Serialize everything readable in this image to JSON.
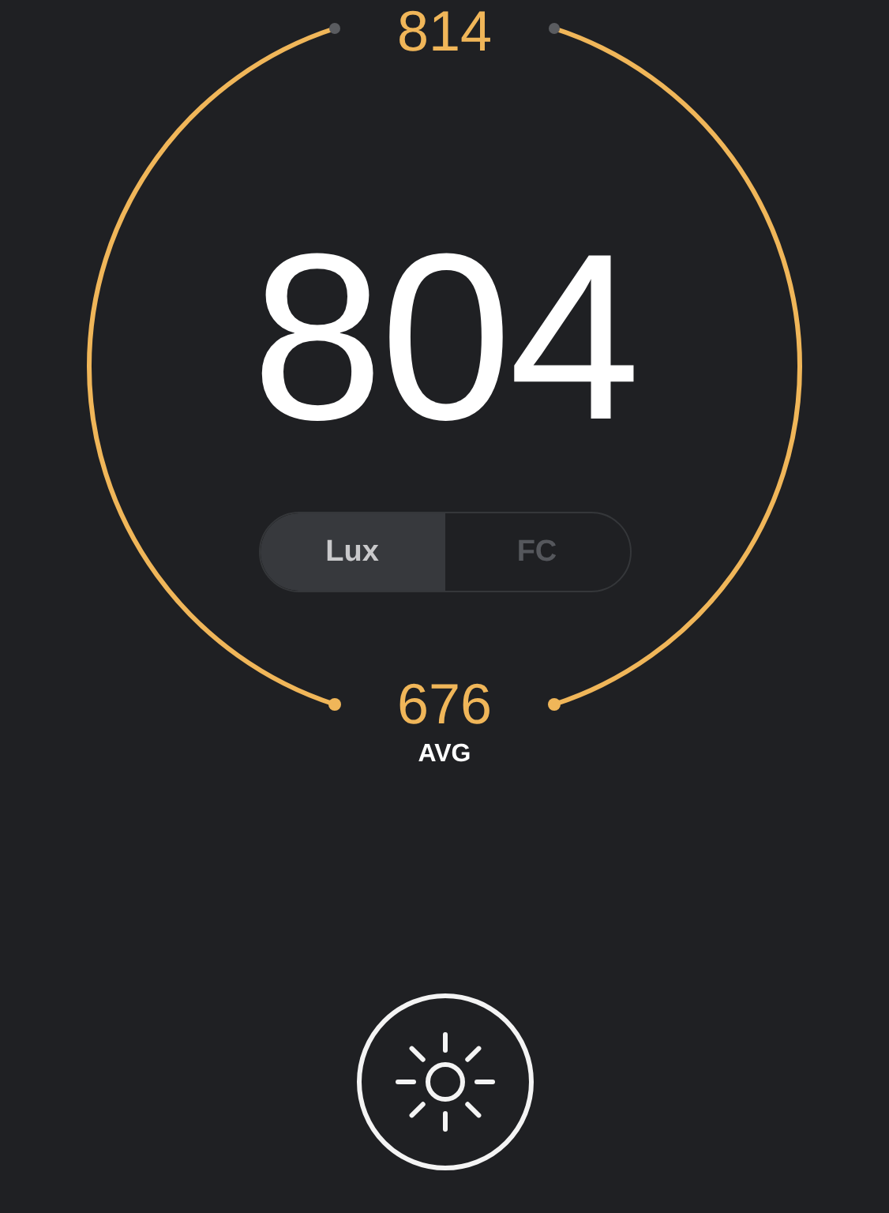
{
  "max": "814",
  "reading": "804",
  "units": [
    {
      "label": "Lux",
      "selected": true
    },
    {
      "label": "FC",
      "selected": false
    }
  ],
  "average": {
    "value": "676",
    "label": "AVG"
  }
}
